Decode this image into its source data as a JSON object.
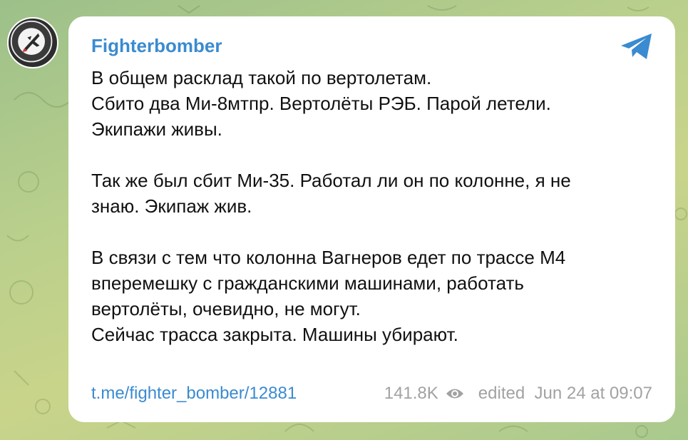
{
  "post": {
    "channel_name": "Fighterbomber",
    "paragraphs": [
      [
        "В общем расклад такой по вертолетам.",
        "Сбито два Ми-8мтпр. Вертолёты РЭБ. Парой летели.",
        "Экипажи живы."
      ],
      [
        "Так же был сбит Ми-35. Работал ли он по колонне, я не",
        "знаю. Экипаж жив."
      ],
      [
        "В связи с тем что колонна Вагнеров едет по трассе М4",
        "вперемешку с гражданскими машинами, работать",
        "вертолёты, очевидно, не могут.",
        "Сейчас трасса закрыта. Машины убирают."
      ]
    ],
    "link": "t.me/fighter_bomber/12881",
    "views": "141.8K",
    "timestamp": "edited  Jun 24 at 09:07"
  },
  "icons": {
    "avatar": "fighterbomber-logo",
    "share": "telegram-plane-icon",
    "views": "eye-icon"
  },
  "colors": {
    "accent": "#3a8bd0",
    "meta_text": "#a2a2a2",
    "bubble": "#ffffff"
  }
}
